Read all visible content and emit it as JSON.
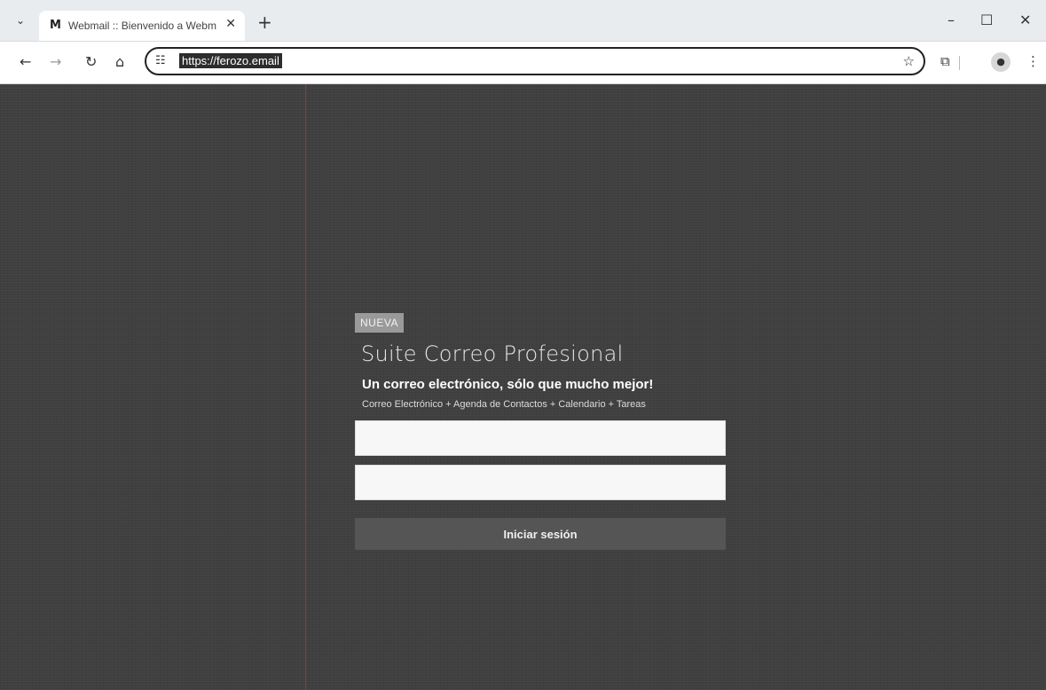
{
  "browser": {
    "tab_title": "Webmail :: Bienvenido a Webm",
    "favicon": "mail-icon",
    "url": "https://ferozo.email"
  },
  "login": {
    "badge": "NUEVA",
    "headline": "Suite Correo Profesional",
    "tagline": "Un correo electrónico, sólo que mucho mejor!",
    "features": "Correo Electrónico + Agenda de Contactos + Calendario + Tareas",
    "username_placeholder": "",
    "password_placeholder": "",
    "submit_label": "Iniciar sesión"
  },
  "colors": {
    "page_background": "#404040",
    "button_background": "#555555",
    "badge_background": "#9a9a9a"
  }
}
